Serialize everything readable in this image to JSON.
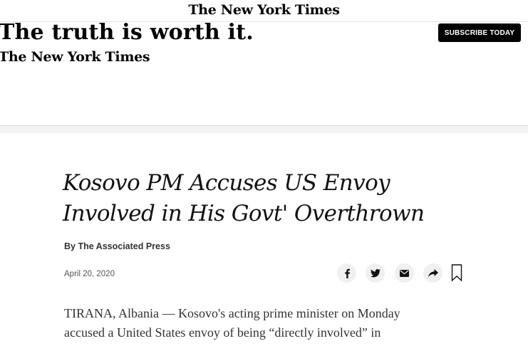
{
  "masthead": {
    "logo_text": "The New York Times"
  },
  "ad": {
    "tagline": "The truth is worth it.",
    "logo_text": "The New York Times",
    "subscribe_label": "SUBSCRIBE TODAY"
  },
  "article": {
    "headline_line1": "Kosovo PM Accuses US Envoy",
    "headline_line2": "Involved in His Govt' Overthrown",
    "byline": "By The Associated Press",
    "date": "April 20, 2020",
    "body_line1": "TIRANA, Albania — Kosovo's acting prime minister on Monday",
    "body_line2": "accused a United States envoy of being “directly involved” in"
  },
  "share_tools": [
    {
      "icon": "facebook-icon"
    },
    {
      "icon": "twitter-icon"
    },
    {
      "icon": "email-icon"
    },
    {
      "icon": "share-icon"
    },
    {
      "icon": "bookmark-icon"
    }
  ],
  "colors": {
    "subscribe_bg": "#000000",
    "share_bg": "#f0f0f0",
    "divider_band": "#f3f3f3"
  }
}
